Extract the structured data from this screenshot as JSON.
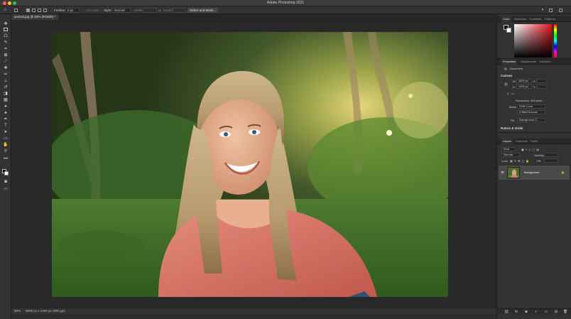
{
  "app": {
    "title": "Adobe Photoshop 2021"
  },
  "options_bar": {
    "feather_label": "Feather:",
    "feather_value": "0 px",
    "antialias_label": "Anti-alias",
    "style_label": "Style:",
    "style_value": "Normal",
    "width_label": "Width:",
    "height_label": "Height:",
    "select_mask_button": "Select and Mask..."
  },
  "document": {
    "tab_label": "portrait.jpg @ 50% (RGB/8) *",
    "zoom": "50%",
    "status_info": "3600 px x 2400 px (300 ppi)"
  },
  "color_panel": {
    "tabs": [
      "Color",
      "Swatches",
      "Gradients",
      "Patterns"
    ],
    "hue_color": "#e2131c"
  },
  "properties_panel": {
    "tabs": [
      "Properties",
      "Adjustments",
      "Libraries"
    ],
    "doc_label": "Document",
    "canvas_title": "Canvas",
    "w_label": "W",
    "w_value": "3600 px",
    "x_label": "X",
    "h_label": "H",
    "h_value": "2400 px",
    "y_label": "Y",
    "resolution": "Resolution: 300 pixel...",
    "mode_label": "Mode",
    "mode_value": "RGB Color",
    "bit_value": "8 Bits/Channel",
    "fill_label": "Fill",
    "fill_value": "Background C...",
    "rulers_title": "Rulers & Grids"
  },
  "layers_panel": {
    "tabs": [
      "Layers",
      "Channels",
      "Paths"
    ],
    "kind_label": "Kind",
    "blend_mode": "Normal",
    "opacity_label": "Opacity:",
    "lock_label": "Lock:",
    "fill_label": "Fill:",
    "layer_name": "Background"
  },
  "colors": {
    "accent": "#e2131c",
    "panel_bg": "#323232",
    "canvas_bg": "#282828"
  }
}
